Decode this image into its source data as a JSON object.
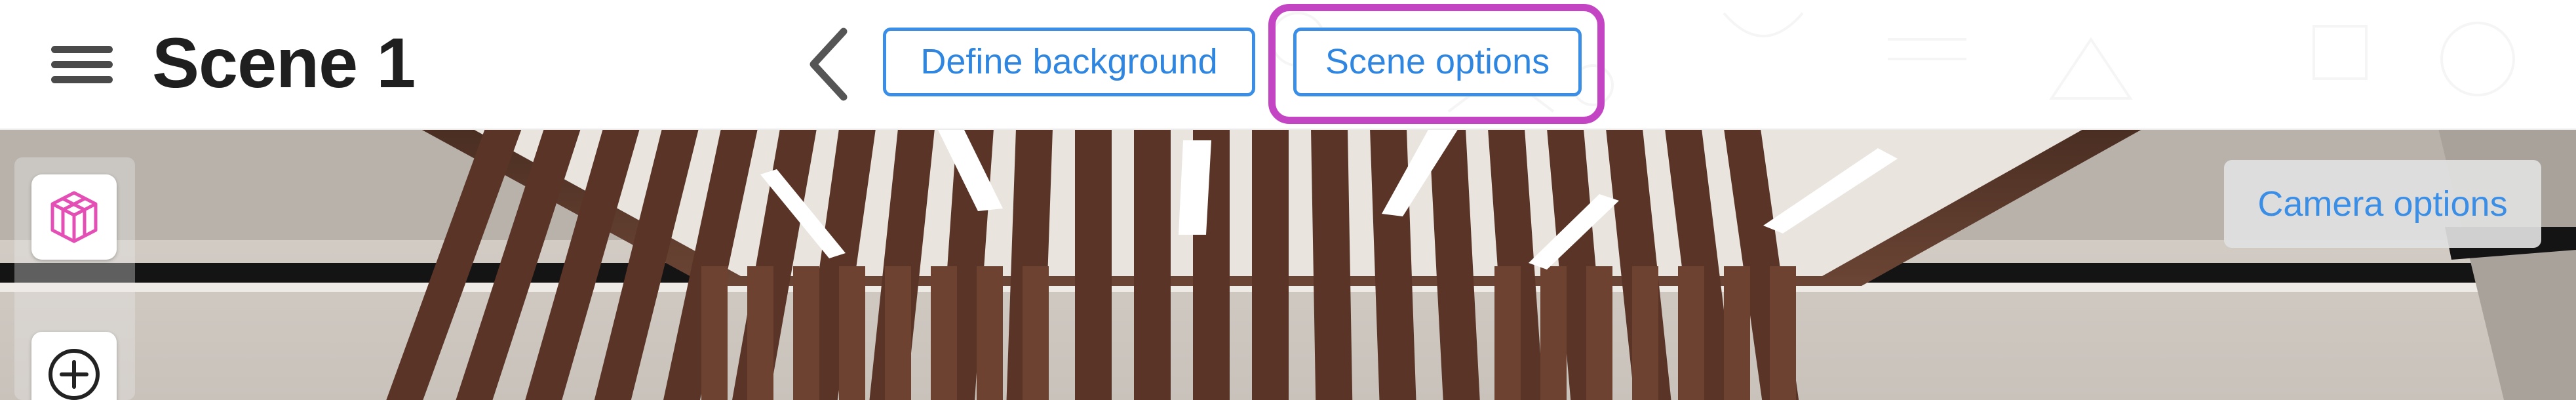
{
  "header": {
    "menu_icon": "hamburger-menu-icon",
    "title": "Scene 1",
    "back_icon": "chevron-left-icon",
    "define_background_label": "Define background",
    "scene_options_label": "Scene options"
  },
  "viewport": {
    "toolbar": {
      "cube_icon": "cube-icon",
      "add_icon": "add-circle-icon"
    },
    "camera_options_label": "Camera options"
  },
  "colors": {
    "accent": "#3a8ee6",
    "highlight": "#c445c4",
    "cube_icon": "#e44fb5"
  }
}
